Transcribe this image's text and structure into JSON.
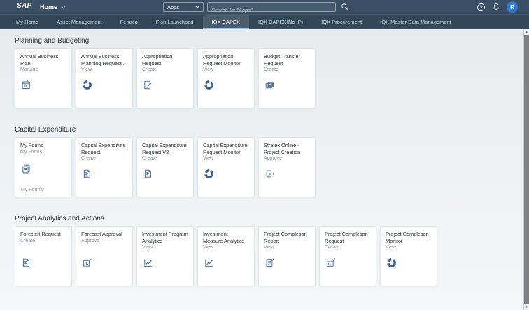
{
  "shell": {
    "logo": "SAP",
    "title": "Home",
    "apps_dropdown": "Apps",
    "search_placeholder": "Search In: \"Apps\"",
    "help_icon": "question-mark",
    "notifications_icon": "bell",
    "search_icon": "magnifier",
    "avatar_initial": "R"
  },
  "nav": {
    "tabs": [
      {
        "label": "My Home",
        "selected": false
      },
      {
        "label": "Asset Management",
        "selected": false
      },
      {
        "label": "Fenaco",
        "selected": false
      },
      {
        "label": "Fiori Launchpad",
        "selected": false
      },
      {
        "label": "IQX CAPEX",
        "selected": true
      },
      {
        "label": "IQX CAPEX(No IP)",
        "selected": false
      },
      {
        "label": "IQX Procurement",
        "selected": false
      },
      {
        "label": "IQX Master Data Management",
        "selected": false
      }
    ]
  },
  "sections": [
    {
      "title": "Planning and Budgeting",
      "tiles": [
        {
          "title": "Annual Business Plan",
          "subtitle": "Manage",
          "icon": "calendar"
        },
        {
          "title": "Annual Business Planning Request...",
          "subtitle": "View",
          "icon": "process-donut"
        },
        {
          "title": "Appropriation Request",
          "subtitle": "Create",
          "icon": "edit-document"
        },
        {
          "title": "Appropriation Request Monitor",
          "subtitle": "View",
          "icon": "process-donut"
        },
        {
          "title": "Budget Transfer Request",
          "subtitle": "Create",
          "icon": "money-transfer"
        }
      ]
    },
    {
      "title": "Capital Expenditure",
      "tiles": [
        {
          "title": "My Forms",
          "subtitle": "My Forms",
          "icon": "documents",
          "footer": "My Forms"
        },
        {
          "title": "Capital Expenditure Request",
          "subtitle": "Create",
          "icon": "money-document"
        },
        {
          "title": "Capital Expenditure Request V2",
          "subtitle": "Create",
          "icon": "money-document"
        },
        {
          "title": "Capital Expenditure Request Monitor",
          "subtitle": "View",
          "icon": "process-donut"
        },
        {
          "title": "Stratex Online - Project Creation",
          "subtitle": "Approve",
          "icon": "arrow-document"
        }
      ]
    },
    {
      "title": "Project Analytics and Actions",
      "tiles": [
        {
          "title": "Forecast Request",
          "subtitle": "Create",
          "icon": "money-document"
        },
        {
          "title": "Forecast Approval",
          "subtitle": "Approve",
          "icon": "chart-check"
        },
        {
          "title": "Investment Program Analytics",
          "subtitle": "View",
          "icon": "trend-chart"
        },
        {
          "title": "Investment Measure Analytics",
          "subtitle": "View",
          "icon": "trend-chart"
        },
        {
          "title": "Project Completion Report",
          "subtitle": "View",
          "icon": "document-check"
        },
        {
          "title": "Project Completion Request",
          "subtitle": "Create",
          "icon": "calendar-check"
        },
        {
          "title": "Project Completion Monitor",
          "subtitle": "View",
          "icon": "process-donut"
        }
      ]
    }
  ],
  "colors": {
    "header_bg": "#3a4f63",
    "nav_bg": "#334758",
    "content_bg_top": "#e7ebee",
    "content_bg_bottom": "#f5f6f7",
    "tile_bg": "#ffffff",
    "icon_color": "#4a729c",
    "donut_color": "#3a6191",
    "avatar_bg": "#2a7ad2",
    "selected_tab_underline": "#9cc3e5",
    "title_text": "#32363a",
    "subtitle_text": "#8e949c"
  }
}
